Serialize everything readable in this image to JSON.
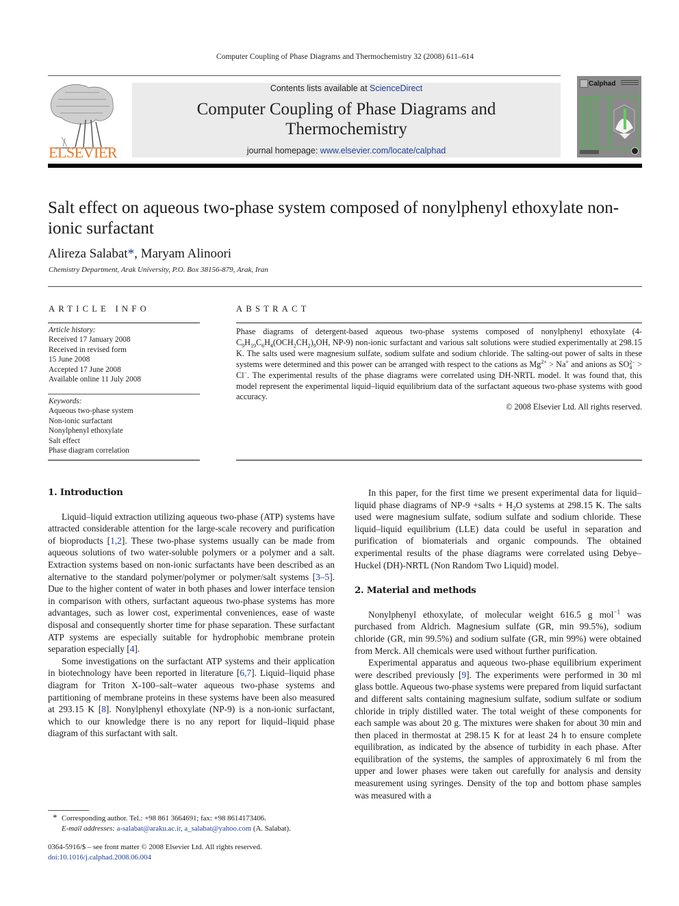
{
  "header": {
    "running_head": "Computer Coupling of Phase Diagrams and Thermochemistry 32 (2008) 611–614",
    "publisher_logo_text": "ELSEVIER",
    "contents_prefix": "Contents lists available at ",
    "contents_link": "ScienceDirect",
    "journal_title_line1": "Computer Coupling of Phase Diagrams and",
    "journal_title_line2": "Thermochemistry",
    "homepage_prefix": "journal homepage: ",
    "homepage_link": "www.elsevier.com/locate/calphad",
    "cover_title": "Calphad",
    "colors": {
      "publisher_orange": "#e87722",
      "link_blue": "#1f3f99",
      "cover_gray": "#8a8a8a",
      "cover_green": "#3cbf3c",
      "journal_box": "#ebebeb"
    }
  },
  "article": {
    "title": "Salt effect on aqueous two-phase system composed of nonylphenyl ethoxylate non-ionic surfactant",
    "author1": "Alireza Salabat",
    "author_star": "*",
    "author_sep": ", ",
    "author2": "Maryam Alinoori",
    "affiliation": "Chemistry Department, Arak University, P.O. Box 38156-879, Arak, Iran"
  },
  "article_info": {
    "heading": "ARTICLE INFO",
    "history_label": "Article history:",
    "history": [
      "Received 17 January 2008",
      "Received in revised form",
      "15 June 2008",
      "Accepted 17 June 2008",
      "Available online 11 July 2008"
    ],
    "keywords_label": "Keywords:",
    "keywords": [
      "Aqueous two-phase system",
      "Non-ionic surfactant",
      "Nonylphenyl ethoxylate",
      "Salt effect",
      "Phase diagram correlation"
    ]
  },
  "abstract": {
    "heading": "ABSTRACT",
    "t1": "Phase diagrams of detergent-based aqueous two-phase systems composed of nonylphenyl ethoxylate (4-C",
    "t2": "H",
    "t3": "C",
    "t4": "H",
    "t5": "(OCH",
    "t6": "CH",
    "t7": ")",
    "t8": "OH, NP-9) non-ionic surfactant and various salt solutions were studied experimentally at 298.15 K. The salts used were magnesium sulfate, sodium sulfate and sodium chloride. The salting-out power of salts in these systems were determined and this power can be arranged with respect to the cations as Mg",
    "t9": " > Na",
    "t10": " and anions as SO",
    "t11": " > Cl",
    "t12": ". The experimental results of the phase diagrams were correlated using DH-NRTL model. It was found that, this model represent the experimental liquid–liquid equilibrium data of the surfactant aqueous two-phase systems with good accuracy.",
    "sub_9": "9",
    "sub_19": "19",
    "sub_6": "6",
    "sub_4": "4",
    "sub_2": "2",
    "sup_2plus": "2+",
    "sup_plus": "+",
    "sup_2minus": "2−",
    "sup_minus": "−",
    "copyright": "© 2008 Elsevier Ltd. All rights reserved."
  },
  "body": {
    "intro_heading": "1.  Introduction",
    "intro_p1_a": "Liquid–liquid extraction utilizing aqueous two-phase (ATP) systems have attracted considerable attention for the large-scale recovery and purification of bioproducts [",
    "intro_p1_ref1": "1,2",
    "intro_p1_b": "]. These two-phase systems usually can be made from aqueous solutions of two water-soluble polymers or a polymer and a salt. Extraction systems based on non-ionic surfactants have been described as an alternative to the standard polymer/polymer or polymer/salt systems [",
    "intro_p1_ref2": "3–5",
    "intro_p1_c": "]. Due to the higher content of water in both phases and lower interface tension in comparison with others, surfactant aqueous two-phase systems has more advantages, such as lower cost, experimental conveniences, ease of waste disposal and consequently shorter time for phase separation. These surfactant ATP systems are especially suitable for hydrophobic membrane protein separation especially [",
    "intro_p1_ref3": "4",
    "intro_p1_d": "].",
    "intro_p2_a": "Some investigations on the surfactant ATP systems and their application in biotechnology have been reported in literature [",
    "intro_p2_ref1": "6,7",
    "intro_p2_b": "]. Liquid–liquid phase diagram for Triton X-100–salt–water aqueous two-phase systems and partitioning of membrane proteins in these systems have been also measured at 293.15 K [",
    "intro_p2_ref2": "8",
    "intro_p2_c": "]. Nonylphenyl ethoxylate (NP-9) is a non-ionic surfactant, which to our knowledge there is no any report for liquid–liquid phase diagram of this surfactant with salt.",
    "right_p1_a": "In this paper, for the first time we present experimental data for liquid–liquid phase diagrams of NP-9 +salts + H",
    "right_p1_sub": "2",
    "right_p1_b": "O systems at 298.15 K. The salts used were magnesium sulfate, sodium sulfate and sodium chloride. These liquid–liquid equilibrium (LLE) data could be useful in separation and purification of biomaterials and organic compounds. The obtained experimental results of the phase diagrams were correlated using Debye–Huckel (DH)-NRTL (Non Random Two Liquid) model.",
    "methods_heading": "2.  Material and methods",
    "methods_p1_a": "Nonylphenyl ethoxylate, of molecular weight 616.5 g mol",
    "methods_p1_sup": "−1",
    "methods_p1_b": " was purchased from Aldrich. Magnesium sulfate (GR, min 99.5%), sodium chloride (GR, min 99.5%) and sodium sulfate (GR, min 99%) were obtained from Merck. All chemicals were used without further purification.",
    "methods_p2_a": "Experimental apparatus and aqueous two-phase equilibrium experiment were described previously [",
    "methods_p2_ref": "9",
    "methods_p2_b": "]. The experiments were performed in 30 ml glass bottle. Aqueous two-phase systems were prepared from liquid surfactant and different salts containing magnesium sulfate, sodium sulfate or sodium chloride in triply distilled water. The total weight of these components for each sample was about 20 g. The mixtures were shaken for about 30 min and then placed in thermostat at 298.15 K for at least 24 h to ensure complete equilibration, as indicated by the absence of turbidity in each phase. After equilibration of the systems, the samples of approximately 6 ml from the upper and lower phases were taken out carefully for analysis and density measurement using syringes. Density of the top and bottom phase samples was measured with a"
  },
  "footnote": {
    "star": "*",
    "corresponding": "Corresponding author. Tel.: +98 861 3664691; fax: +98 8614173406.",
    "email_label": "E-mail addresses:",
    "email1": "a-salabat@araku.ac.ir",
    "email_sep": ", ",
    "email2": "a_salabat@yahoo.com",
    "email_suffix": " (A. Salabat).",
    "issn_line": "0364-5916/$ – see front matter © 2008 Elsevier Ltd. All rights reserved.",
    "doi": "doi:10.1016/j.calphad.2008.06.004"
  }
}
